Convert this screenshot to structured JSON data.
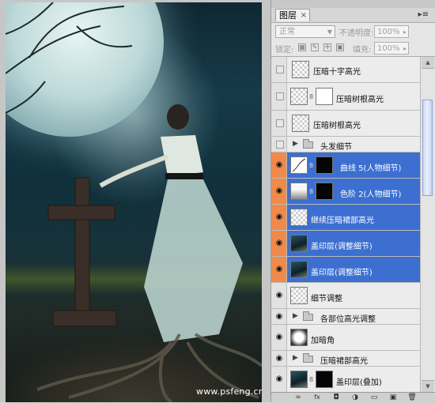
{
  "watermark": "www.psfeng.cn",
  "panel": {
    "tab_label": "图层",
    "tab_close": "×",
    "menu_glyph": "▸≡",
    "blend_mode": "正常",
    "opacity_label": "不透明度:",
    "opacity_value": "100%",
    "lock_label": "锁定:",
    "fill_label": "填充:",
    "fill_value": "100%"
  },
  "layers": [
    {
      "name": "压暗十字高光",
      "visible": false,
      "selected": false,
      "kind": "layer"
    },
    {
      "name": "压暗树根高光",
      "visible": false,
      "selected": false,
      "kind": "layer-mask"
    },
    {
      "name": "压暗树根高光",
      "visible": false,
      "selected": false,
      "kind": "layer"
    },
    {
      "name": "头发细节",
      "visible": false,
      "selected": false,
      "kind": "group"
    },
    {
      "name": "曲线 5(人物细节)",
      "visible": true,
      "selected": true,
      "kind": "curves"
    },
    {
      "name": "色阶 2(人物细节)",
      "visible": true,
      "selected": true,
      "kind": "levels"
    },
    {
      "name": "继续压暗裙部高光",
      "visible": true,
      "selected": true,
      "kind": "layer"
    },
    {
      "name": "盖印层(调整细节)",
      "visible": true,
      "selected": true,
      "kind": "photo"
    },
    {
      "name": "盖印层(调整细节)",
      "visible": true,
      "selected": true,
      "kind": "photo"
    },
    {
      "name": "细节调整",
      "visible": true,
      "selected": false,
      "kind": "layer"
    },
    {
      "name": "各部位高光调整",
      "visible": true,
      "selected": false,
      "kind": "group"
    },
    {
      "name": "加暗角",
      "visible": true,
      "selected": false,
      "kind": "layer"
    },
    {
      "name": "压暗裙部高光",
      "visible": true,
      "selected": false,
      "kind": "group"
    },
    {
      "name": "盖印层(叠加)",
      "visible": true,
      "selected": false,
      "kind": "photo-mask"
    }
  ],
  "icons": {
    "eye": "eye-icon",
    "folder": "folder-icon",
    "chain": "link-icon",
    "bottom": [
      "link-layers-icon",
      "fx-icon",
      "mask-icon",
      "adjustment-icon",
      "group-icon",
      "new-layer-icon",
      "trash-icon"
    ]
  },
  "bottom_glyphs": [
    "∞",
    "fx",
    "◘",
    "◑",
    "▭",
    "▣",
    "🗑"
  ],
  "colors": {
    "selection": "#3c6fd0",
    "visibility_highlight": "#f08a4b"
  }
}
